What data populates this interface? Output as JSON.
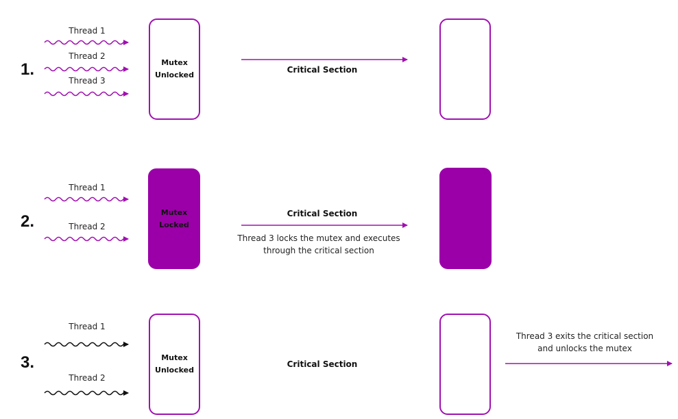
{
  "colors": {
    "accent": "#a010b0",
    "locked_fill": "#9b00a8",
    "text": "#111111",
    "idle_wave": "#111111"
  },
  "steps": [
    {
      "number": "1.",
      "threads": [
        "Thread 1",
        "Thread 2",
        "Thread 3"
      ],
      "thread_color": "accent",
      "mutex": {
        "label": "Mutex\nUnlocked",
        "state": "unlocked"
      },
      "critical_section_label": "Critical Section",
      "note": "",
      "target_box_state": "unlocked"
    },
    {
      "number": "2.",
      "threads": [
        "Thread 1",
        "Thread 2"
      ],
      "thread_color": "accent",
      "mutex": {
        "label": "Mutex\nLocked",
        "state": "locked"
      },
      "critical_section_label": "Critical Section",
      "note": "Thread 3 locks the mutex and executes\nthrough the critical section",
      "target_box_state": "locked"
    },
    {
      "number": "3.",
      "threads": [
        "Thread 1",
        "Thread 2"
      ],
      "thread_color": "black",
      "mutex": {
        "label": "Mutex\nUnlocked",
        "state": "unlocked"
      },
      "critical_section_label": "Critical Section",
      "note": "Thread 3 exits the critical section\nand unlocks the mutex",
      "target_box_state": "unlocked"
    }
  ]
}
